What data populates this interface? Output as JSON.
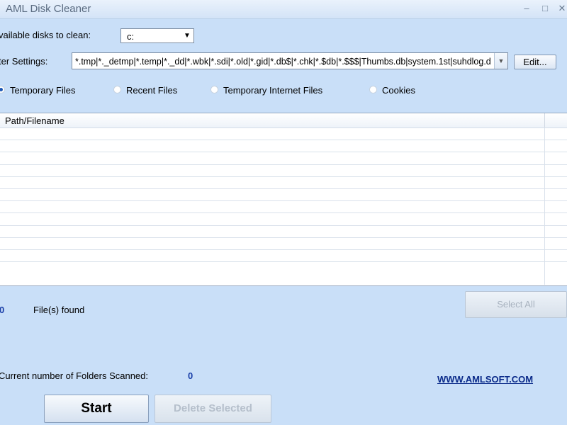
{
  "window": {
    "title": "AML Disk Cleaner",
    "min_glyph": "–",
    "max_glyph": "□",
    "close_glyph": "✕"
  },
  "disks": {
    "label": "vailable disks to clean:",
    "selected": "c:"
  },
  "filter": {
    "label": "ter Settings:",
    "value": "*.tmp|*._detmp|*.temp|*._dd|*.wbk|*.sdi|*.old|*.gid|*.db$|*.chk|*.$db|*.$$$|Thumbs.db|system.1st|suhdlog.d",
    "edit_label": "Edit..."
  },
  "scan_types": [
    {
      "label": "Temporary Files",
      "selected": true
    },
    {
      "label": "Recent Files",
      "selected": false
    },
    {
      "label": "Temporary Internet Files",
      "selected": false
    },
    {
      "label": "Cookies",
      "selected": false
    }
  ],
  "list": {
    "column": "Path/Filename",
    "row_count": 11
  },
  "found": {
    "count": "0",
    "label": "File(s) found"
  },
  "select_all_label": "Select All",
  "folders": {
    "label": "Current number of Folders Scanned:",
    "count": "0"
  },
  "website": "WWW.AMLSOFT.COM",
  "start_label": "Start",
  "delete_label": "Delete Selected",
  "icons": {
    "dropdown": "triangle-down"
  }
}
